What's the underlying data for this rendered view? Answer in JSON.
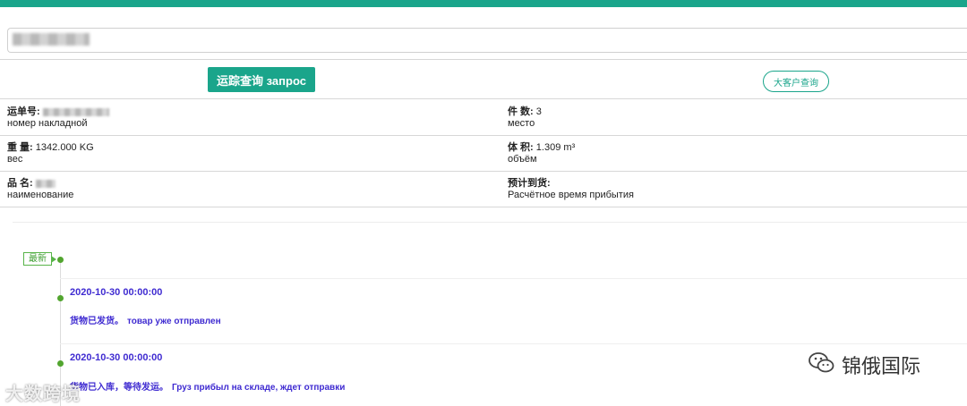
{
  "search": {
    "value": ""
  },
  "buttons": {
    "query_label": "运踪查询 запрос",
    "vip_label": "大客户查询"
  },
  "fields": {
    "waybill": {
      "cn": "运单号:",
      "ru": "номер накладной"
    },
    "pieces": {
      "cn": "件 数:",
      "value": "3",
      "ru": "место"
    },
    "weight": {
      "cn": "重 量:",
      "value": "1342.000 KG",
      "ru": "вес"
    },
    "volume": {
      "cn": "体 积:",
      "value": "1.309 m³",
      "ru": "объём"
    },
    "product": {
      "cn": "品 名:",
      "ru": "наименование"
    },
    "eta": {
      "cn": "预计到货:",
      "ru": "Расчётное время прибытия"
    }
  },
  "timeline": {
    "badge": "最新",
    "events": [
      {
        "time": "2020-10-30 00:00:00",
        "status_cn": "货物已发货。",
        "status_ru": "товар уже отправлен"
      },
      {
        "time": "2020-10-30 00:00:00",
        "status_cn": "货物已入库，等待发运。",
        "status_ru": "Груз прибыл на складе, ждет отправки"
      }
    ]
  },
  "watermarks": {
    "left": "大数跨境",
    "right": "锦俄国际"
  },
  "colors": {
    "brand": "#1aa58b",
    "event_text": "#3f2bd1",
    "timeline_dot": "#52a52f",
    "badge": "#58b449"
  }
}
